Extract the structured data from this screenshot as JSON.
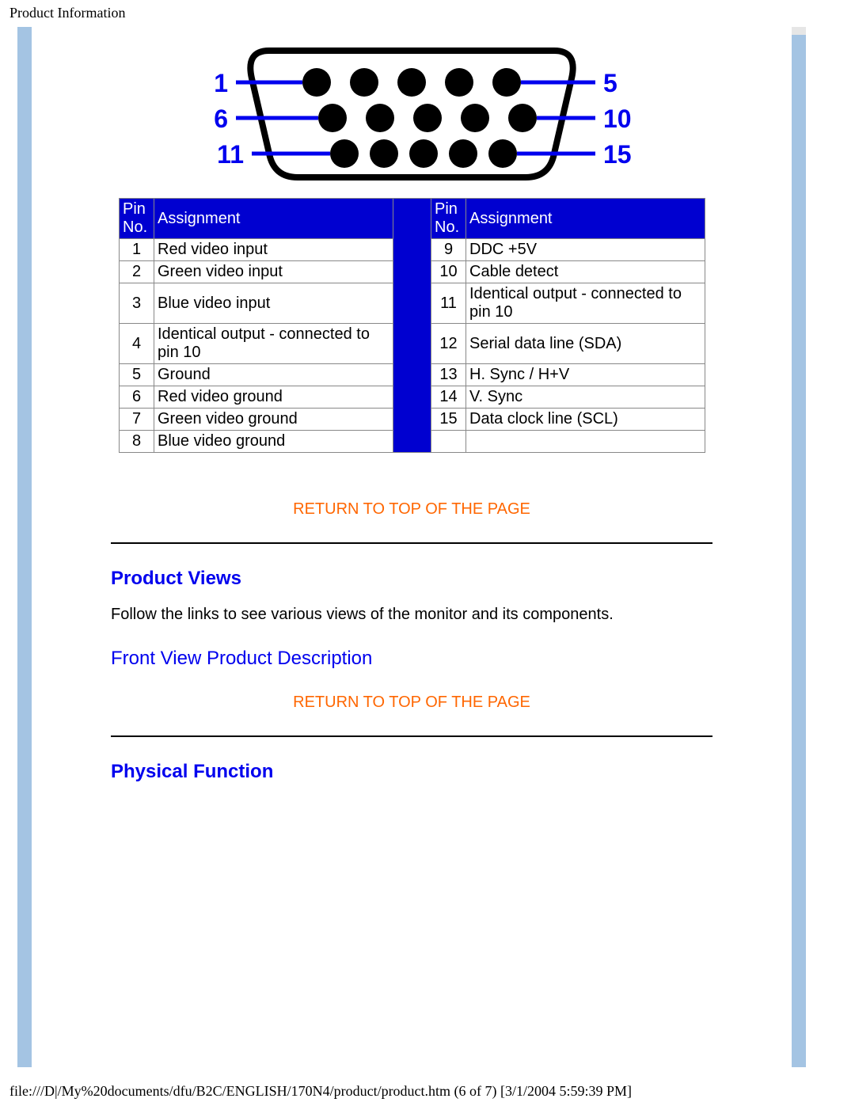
{
  "page_title": "Product Information",
  "connector_labels": {
    "left": [
      "1",
      "6",
      "11"
    ],
    "right": [
      "5",
      "10",
      "15"
    ]
  },
  "pin_headers": {
    "pin_no": "Pin No.",
    "assignment": "Assignment"
  },
  "pins_left": [
    {
      "no": "1",
      "txt": "Red video input"
    },
    {
      "no": "2",
      "txt": "Green video input"
    },
    {
      "no": "3",
      "txt": "Blue video input"
    },
    {
      "no": "4",
      "txt": "Identical output - connected to pin 10"
    },
    {
      "no": "5",
      "txt": "Ground"
    },
    {
      "no": "6",
      "txt": "Red video ground"
    },
    {
      "no": "7",
      "txt": "Green video ground"
    },
    {
      "no": "8",
      "txt": "Blue video ground"
    }
  ],
  "pins_right": [
    {
      "no": "9",
      "txt": "DDC +5V"
    },
    {
      "no": "10",
      "txt": "Cable detect"
    },
    {
      "no": "11",
      "txt": "Identical output - connected to pin 10"
    },
    {
      "no": "12",
      "txt": "Serial data line (SDA)"
    },
    {
      "no": "13",
      "txt": "H. Sync / H+V"
    },
    {
      "no": "14",
      "txt": "V. Sync"
    },
    {
      "no": "15",
      "txt": "Data clock line (SCL)"
    }
  ],
  "links": {
    "return_top": "RETURN TO TOP OF THE PAGE",
    "front_view": "Front View Product Description"
  },
  "sections": {
    "product_views": "Product Views",
    "product_views_text": "Follow the links to see various views of the monitor and its components.",
    "physical_function": "Physical Function"
  },
  "footer": "file:///D|/My%20documents/dfu/B2C/ENGLISH/170N4/product/product.htm (6 of 7) [3/1/2004 5:59:39 PM]",
  "chart_data": {
    "type": "table",
    "title": "15-pin D-sub signal cable pin assignment",
    "columns": [
      "Pin No.",
      "Assignment"
    ],
    "rows": [
      [
        1,
        "Red video input"
      ],
      [
        2,
        "Green video input"
      ],
      [
        3,
        "Blue video input"
      ],
      [
        4,
        "Identical output - connected to pin 10"
      ],
      [
        5,
        "Ground"
      ],
      [
        6,
        "Red video ground"
      ],
      [
        7,
        "Green video ground"
      ],
      [
        8,
        "Blue video ground"
      ],
      [
        9,
        "DDC +5V"
      ],
      [
        10,
        "Cable detect"
      ],
      [
        11,
        "Identical output - connected to pin 10"
      ],
      [
        12,
        "Serial data line (SDA)"
      ],
      [
        13,
        "H. Sync / H+V"
      ],
      [
        14,
        "V. Sync"
      ],
      [
        15,
        "Data clock line (SCL)"
      ]
    ]
  }
}
